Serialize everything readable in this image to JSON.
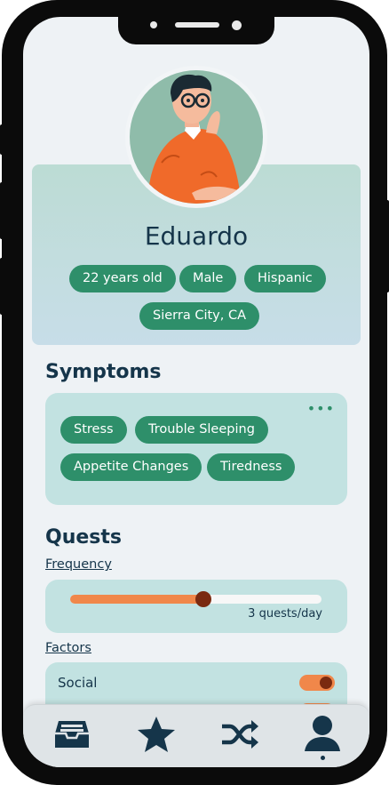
{
  "profile": {
    "name": "Eduardo",
    "tags": [
      "22 years old",
      "Male",
      "Hispanic",
      "Sierra City, CA"
    ]
  },
  "symptoms": {
    "title": "Symptoms",
    "more_icon": "more-dots-icon",
    "items": [
      "Stress",
      "Trouble Sleeping",
      "Appetite Changes",
      "Tiredness"
    ]
  },
  "quests": {
    "title": "Quests",
    "frequency_label": "Frequency",
    "frequency_value": "3 quests/day",
    "frequency_level": 0.53,
    "factors_label": "Factors",
    "factors": [
      {
        "label": "Social",
        "on": true
      },
      {
        "label": "",
        "on": true
      }
    ]
  },
  "nav": {
    "items": [
      "inbox-icon",
      "star-icon",
      "shuffle-icon",
      "profile-icon"
    ],
    "active": "profile-icon"
  },
  "colors": {
    "accent_green": "#2e8f6a",
    "accent_orange": "#f0874a",
    "dark_navy": "#15354a",
    "panel_teal": "#c2e2e1"
  }
}
